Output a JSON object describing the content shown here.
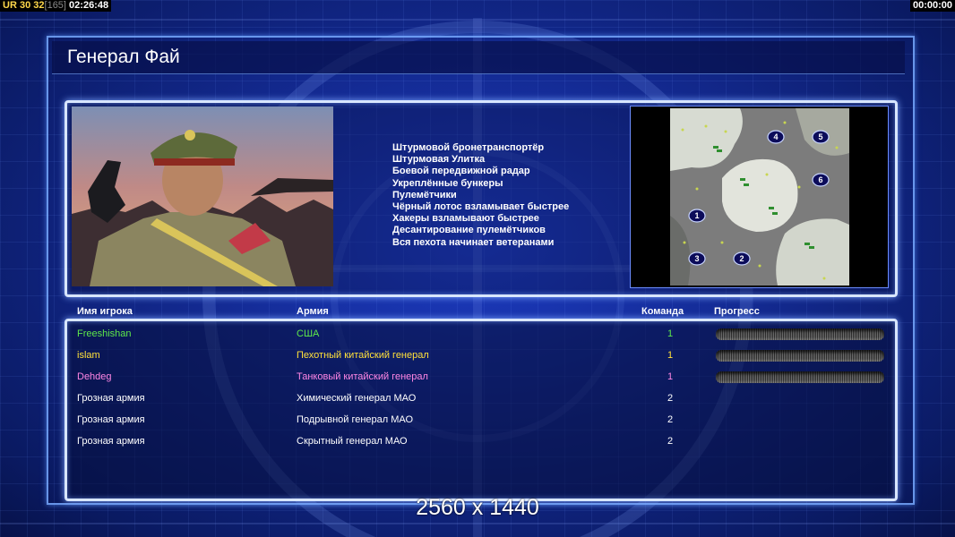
{
  "hud": {
    "ur_label": "UR",
    "value_30": "30",
    "value_32": "32",
    "bracket_value": "[165]",
    "clock_left": "02:26:48",
    "clock_right": "00:00:00"
  },
  "title": "Генерал Фай",
  "abilities": [
    "Штурмовой бронетранспортёр",
    "Штурмовая Улитка",
    "Боевой передвижной радар",
    "Укреплённые бункеры",
    "Пулемётчики",
    "Чёрный лотос взламывает быстрее",
    "Хакеры взламывают быстрее",
    "Десантирование пулемётчиков",
    "Вся пехота начинает ветеранами"
  ],
  "map": {
    "start_positions": [
      "1",
      "2",
      "3",
      "4",
      "5",
      "6"
    ]
  },
  "table": {
    "headers": {
      "player": "Имя игрока",
      "army": "Армия",
      "team": "Команда",
      "progress": "Прогресс"
    },
    "rows": [
      {
        "name": "Freeshishan",
        "army": "США",
        "team": "1",
        "color": "#5ee84a",
        "progress_shown": true
      },
      {
        "name": "islam",
        "army": "Пехотный китайский генерал",
        "team": "1",
        "color": "#ffe03a",
        "progress_shown": true
      },
      {
        "name": "Dehdeg",
        "army": "Танковый китайский генерал",
        "team": "1",
        "color": "#ff86e4",
        "progress_shown": true
      },
      {
        "name": "Грозная армия",
        "army": "Химический генерал МАО",
        "team": "2",
        "color": "#ffffff",
        "progress_shown": false
      },
      {
        "name": "Грозная армия",
        "army": "Подрывной генерал МАО",
        "team": "2",
        "color": "#ffffff",
        "progress_shown": false
      },
      {
        "name": "Грозная армия",
        "army": "Скрытный генерал МАО",
        "team": "2",
        "color": "#ffffff",
        "progress_shown": false
      }
    ]
  },
  "resolution": "2560 x 1440",
  "colors": {
    "background": "#13298f",
    "frame": "#d8e6ff",
    "hud_yellow": "#ffd84a"
  }
}
